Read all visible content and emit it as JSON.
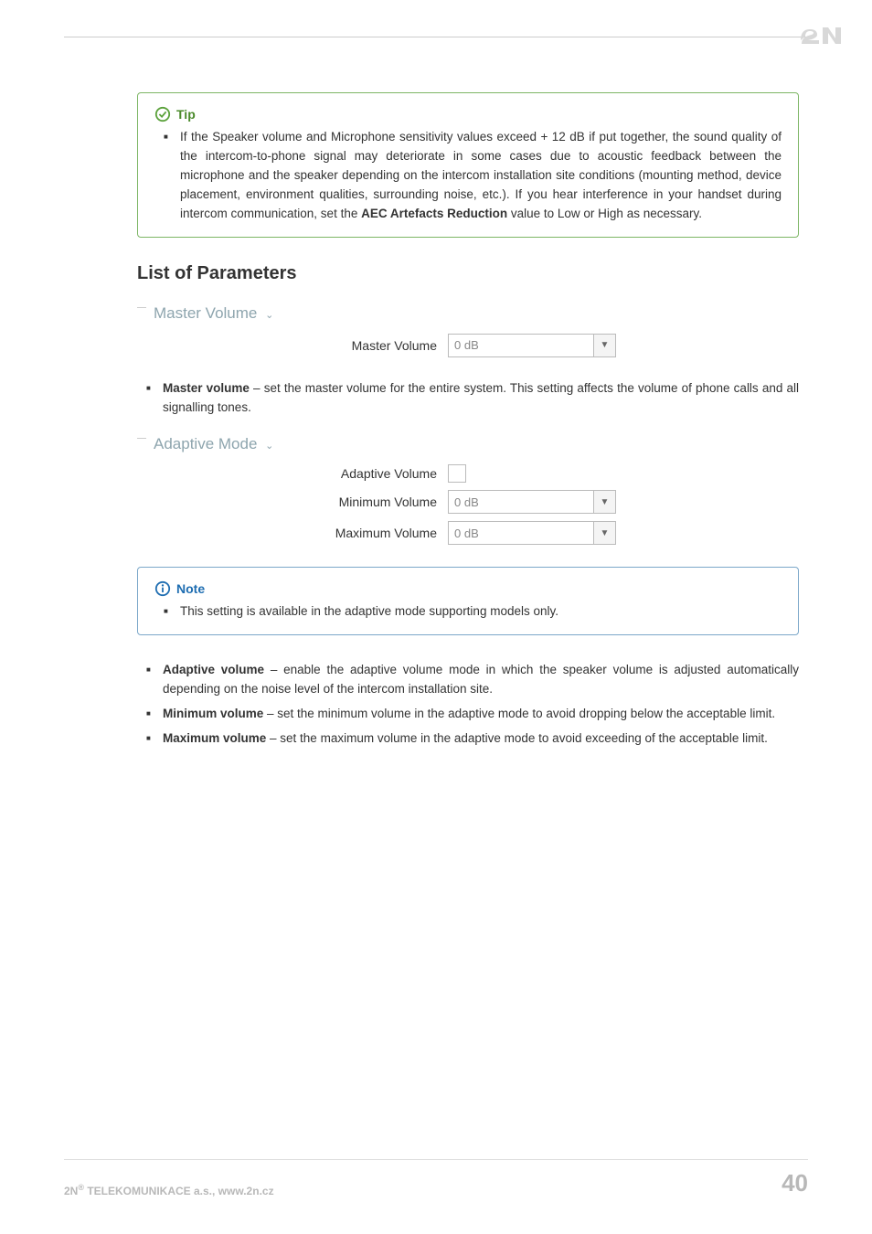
{
  "logo": {
    "name": "2N"
  },
  "tip": {
    "heading": "Tip",
    "body": "If the Speaker volume and Microphone sensitivity values exceed + 12 dB if put together, the sound quality of the intercom-to-phone signal may deteriorate in some cases due to acoustic feedback between the microphone and the speaker depending on the intercom installation site conditions (mounting method, device placement, environment qualities, surrounding noise, etc.). If you hear interference in your handset during intercom communication, set the ",
    "strong": "AEC Artefacts Reduction",
    "body_tail": " value to Low or High as necessary."
  },
  "section_title": "List of Parameters",
  "group1": {
    "title": "Master Volume",
    "field_label": "Master Volume",
    "field_value": "0 dB"
  },
  "desc1": {
    "strong": "Master volume",
    "text": " – set the master volume for the entire system. This setting affects the volume of phone calls and all signalling tones."
  },
  "group2": {
    "title": "Adaptive Mode",
    "f1_label": "Adaptive Volume",
    "f2_label": "Minimum Volume",
    "f2_value": "0 dB",
    "f3_label": "Maximum Volume",
    "f3_value": "0 dB"
  },
  "note": {
    "heading": "Note",
    "body": "This setting is available in the adaptive mode supporting models only."
  },
  "desc2": [
    {
      "strong": "Adaptive volume",
      "text": " – enable the adaptive volume mode in which the speaker volume is adjusted automatically depending on the noise level of the intercom installation site."
    },
    {
      "strong": "Minimum volume",
      "text": " – set the minimum volume in the adaptive mode to avoid dropping below the acceptable limit."
    },
    {
      "strong": "Maximum volume",
      "text": " – set the maximum volume in the adaptive mode to avoid exceeding of the acceptable limit."
    }
  ],
  "footer": {
    "company_prefix": "2N",
    "company_text": " TELEKOMUNIKACE a.s., www.2n.cz",
    "page": "40"
  }
}
